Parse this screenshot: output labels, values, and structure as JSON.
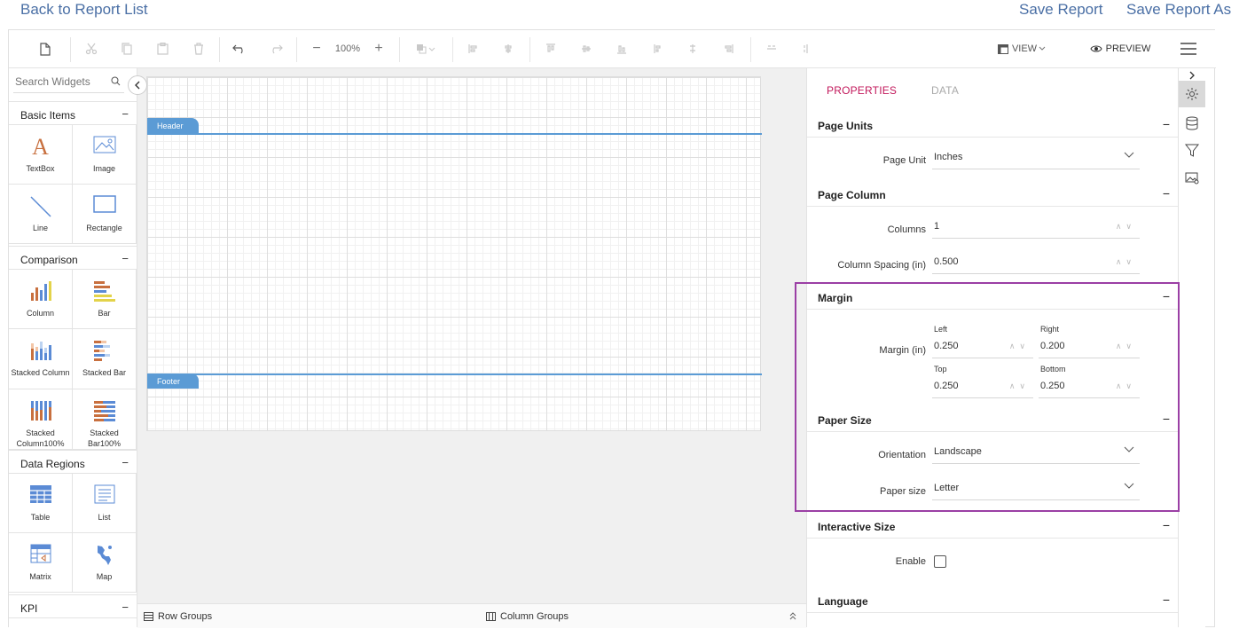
{
  "top_links": {
    "back": "Back to Report List",
    "save": "Save Report",
    "save_as": "Save Report As"
  },
  "toolbar": {
    "zoom": "100%",
    "view_label": "VIEW",
    "preview_label": "PREVIEW"
  },
  "widgets": {
    "search_placeholder": "Search Widgets",
    "categories": [
      {
        "name": "Basic Items",
        "items": [
          "TextBox",
          "Image",
          "Line",
          "Rectangle"
        ]
      },
      {
        "name": "Comparison",
        "items": [
          "Column",
          "Bar",
          "Stacked Column",
          "Stacked Bar",
          "Stacked Column100%",
          "Stacked Bar100%"
        ]
      },
      {
        "name": "Data Regions",
        "items": [
          "Table",
          "List",
          "Matrix",
          "Map"
        ]
      },
      {
        "name": "KPI",
        "items": []
      }
    ]
  },
  "canvas": {
    "header_band": "Header",
    "footer_band": "Footer"
  },
  "group_bar": {
    "row_groups": "Row Groups",
    "column_groups": "Column Groups"
  },
  "properties": {
    "tabs": {
      "properties": "PROPERTIES",
      "data": "DATA"
    },
    "page_units": {
      "title": "Page Units",
      "page_unit_label": "Page Unit",
      "page_unit_value": "Inches"
    },
    "page_column": {
      "title": "Page Column",
      "columns_label": "Columns",
      "columns_value": "1",
      "spacing_label": "Column Spacing (in)",
      "spacing_value": "0.500"
    },
    "margin": {
      "title": "Margin",
      "label": "Margin (in)",
      "left_label": "Left",
      "left_value": "0.250",
      "right_label": "Right",
      "right_value": "0.200",
      "top_label": "Top",
      "top_value": "0.250",
      "bottom_label": "Bottom",
      "bottom_value": "0.250"
    },
    "paper_size": {
      "title": "Paper Size",
      "orientation_label": "Orientation",
      "orientation_value": "Landscape",
      "size_label": "Paper size",
      "size_value": "Letter"
    },
    "interactive_size": {
      "title": "Interactive Size",
      "enable_label": "Enable",
      "enabled": false
    },
    "language": {
      "title": "Language"
    }
  },
  "colors": {
    "accent": "#c2185b",
    "band": "#5b9bd5",
    "highlight": "#9b3fa5",
    "link": "#4a6fa5"
  }
}
